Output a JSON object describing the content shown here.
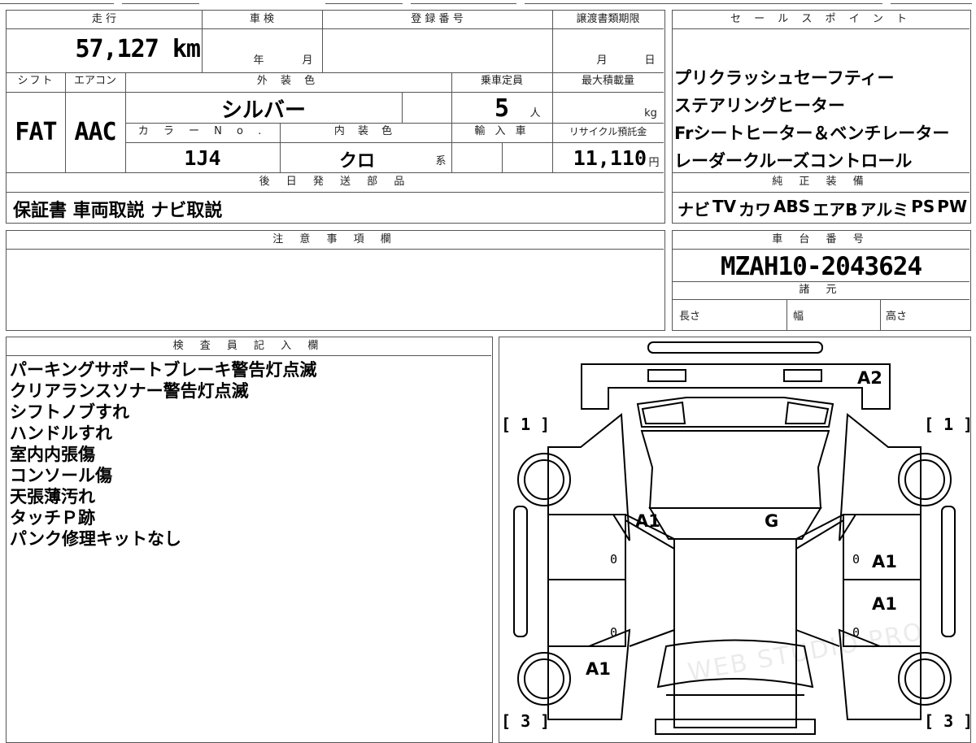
{
  "labels": {
    "mileage": "走 行",
    "inspection": "車 検",
    "registration": "登 録 番 号",
    "transfer_deadline": "譲渡書類期限",
    "sales_point": "セ ー ル ス ポ イ ン ト",
    "year": "年",
    "month": "月",
    "day": "日",
    "shift": "シフト",
    "aircon": "エアコン",
    "exterior_color": "外 装 色",
    "capacity": "乗車定員",
    "max_load": "最大積載量",
    "color_no": "カ ラ ー N o .",
    "interior_color": "内 装 色",
    "import": "輸 入 車",
    "recycle": "リサイクル預託金",
    "persons": "人",
    "kg": "kg",
    "yen": "円",
    "kei": "系",
    "later_parts": "後 日 発 送 部 品",
    "genuine_equipment": "純 正 装 備",
    "caution": "注 意 事 項 欄",
    "chassis_no": "車 台 番 号",
    "specs": "諸 元",
    "length": "長さ",
    "width": "幅",
    "height": "高さ",
    "inspector": "検 査 員 記 入 欄"
  },
  "values": {
    "mileage": "57,127 km",
    "shift": "FAT",
    "aircon": "AAC",
    "exterior_color": "シルバー",
    "capacity": "5",
    "color_no": "1J4",
    "interior_color": "クロ",
    "recycle": "11,110",
    "later_parts": "保証書 車両取説 ナビ取説",
    "chassis_no": "MZAH10-2043624"
  },
  "sales_points": [
    "プリクラッシュセーフティー",
    "ステアリングヒーター",
    "Frシートヒーター＆ベンチレーター",
    "レーダークルーズコントロール"
  ],
  "genuine_equipment": [
    "ナビ",
    "TV",
    "カワ",
    "ABS",
    "エアB",
    "アルミ",
    "PS",
    "PW"
  ],
  "inspector_notes": [
    "パーキングサポートブレーキ警告灯点滅",
    "クリアランスソナー警告灯点滅",
    "シフトノブすれ",
    "ハンドルすれ",
    "室内内張傷",
    "コンソール傷",
    "天張薄汚れ",
    "タッチＰ跡",
    "パンク修理キットなし"
  ],
  "diagram": {
    "marks": {
      "rear_right_top": "A2",
      "front_left_fender": "A1",
      "hood": "G",
      "right_door_front": "A1",
      "right_door_rear": "A1",
      "left_rear_fender": "A1"
    },
    "zeros": [
      "0",
      "0",
      "0",
      "0"
    ],
    "bracket_1": "[ 1 ]",
    "bracket_3": "[ 3 ]",
    "watermark": "WEB STUDIO PRO"
  }
}
